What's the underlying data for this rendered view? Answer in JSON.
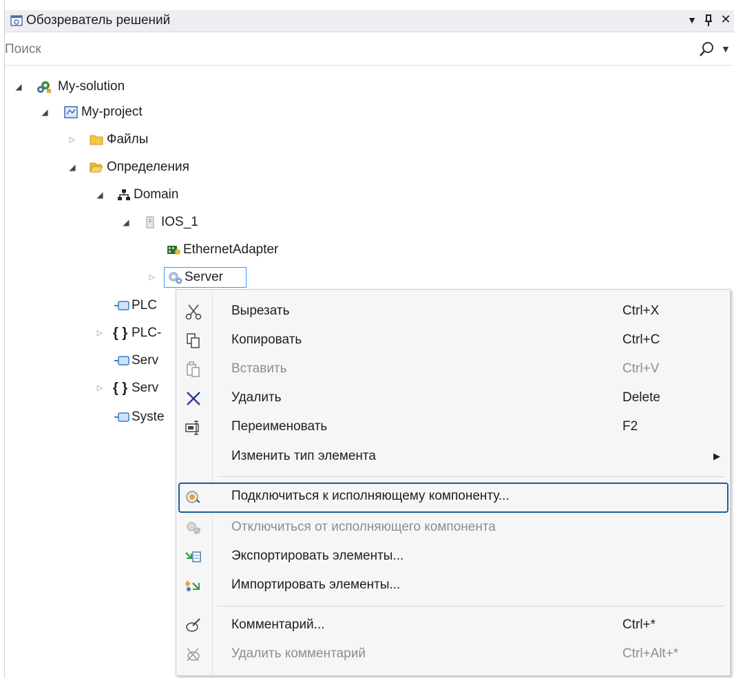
{
  "window": {
    "title": "Обозреватель решений",
    "dropdown_glyph": "▼",
    "pin_glyph": "ꟼ",
    "close_glyph": "✕"
  },
  "search": {
    "placeholder": "Поиск",
    "icon": "search-icon"
  },
  "tree": {
    "solution": "My-solution",
    "project": "My-project",
    "files": "Файлы",
    "definitions": "Определения",
    "domain": "Domain",
    "ios": "IOS_1",
    "adapter": "EthernetAdapter",
    "server": "Server",
    "plc": "PLC",
    "plc_types": "PLC-",
    "serv1": "Serv",
    "serv2": "Serv",
    "syst": "Syste"
  },
  "context_menu": {
    "items": [
      {
        "label": "Вырезать",
        "shortcut": "Ctrl+X",
        "icon": "scissors-icon",
        "enabled": true
      },
      {
        "label": "Копировать",
        "shortcut": "Ctrl+C",
        "icon": "copy-icon",
        "enabled": true
      },
      {
        "label": "Вставить",
        "shortcut": "Ctrl+V",
        "icon": "paste-icon",
        "enabled": false
      },
      {
        "label": "Удалить",
        "shortcut": "Delete",
        "icon": "delete-x-icon",
        "enabled": true
      },
      {
        "label": "Переименовать",
        "shortcut": "F2",
        "icon": "rename-icon",
        "enabled": true
      },
      {
        "label": "Изменить тип элемента",
        "shortcut": "",
        "icon": "",
        "enabled": true,
        "submenu": true
      },
      {
        "label": "Подключиться к исполняющему компоненту...",
        "shortcut": "",
        "icon": "connect-icon",
        "enabled": true,
        "focused": true
      },
      {
        "label": "Отключиться от исполняющего компонента",
        "shortcut": "",
        "icon": "disconnect-icon",
        "enabled": false
      },
      {
        "label": "Экспортировать элементы...",
        "shortcut": "",
        "icon": "export-icon",
        "enabled": true
      },
      {
        "label": "Импортировать элементы...",
        "shortcut": "",
        "icon": "import-icon",
        "enabled": true
      },
      {
        "label": "Комментарий...",
        "shortcut": "Ctrl+*",
        "icon": "comment-icon",
        "enabled": true
      },
      {
        "label": "Удалить комментарий",
        "shortcut": "Ctrl+Alt+*",
        "icon": "remove-comment-icon",
        "enabled": false
      }
    ],
    "submenu_glyph": "▶"
  },
  "colors": {
    "accent_focus": "#1c5b97",
    "selection": "#3399ff",
    "disabled_text": "#8d8d8d"
  }
}
